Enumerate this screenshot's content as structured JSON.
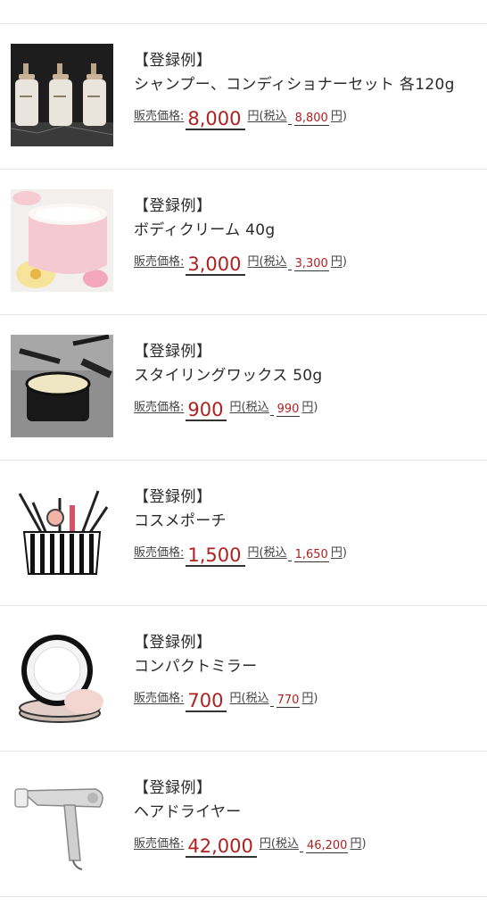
{
  "items": [
    {
      "tag": "【登録例】",
      "name": "シャンプー、コンディショナーセット 各120g",
      "label": "販売価格:",
      "price": "8,000",
      "yen": "円",
      "tax_open": "(税込",
      "tax_price": "8,800",
      "yen2": "円",
      "tax_close": ")",
      "icon": "shampoo-bottles-image"
    },
    {
      "tag": "【登録例】",
      "name": "ボディクリーム 40g",
      "label": "販売価格:",
      "price": "3,000",
      "yen": "円",
      "tax_open": "(税込",
      "tax_price": "3,300",
      "yen2": "円",
      "tax_close": ")",
      "icon": "body-cream-jar-image"
    },
    {
      "tag": "【登録例】",
      "name": "スタイリングワックス 50g",
      "label": "販売価格:",
      "price": "900",
      "yen": "円",
      "tax_open": "(税込",
      "tax_price": "990",
      "yen2": "円",
      "tax_close": ")",
      "icon": "styling-wax-image"
    },
    {
      "tag": "【登録例】",
      "name": "コスメポーチ",
      "label": "販売価格:",
      "price": "1,500",
      "yen": "円",
      "tax_open": "(税込",
      "tax_price": "1,650",
      "yen2": "円",
      "tax_close": ")",
      "icon": "cosme-pouch-image"
    },
    {
      "tag": "【登録例】",
      "name": "コンパクトミラー",
      "label": "販売価格:",
      "price": "700",
      "yen": "円",
      "tax_open": "(税込",
      "tax_price": "770",
      "yen2": "円",
      "tax_close": ")",
      "icon": "compact-mirror-image"
    },
    {
      "tag": "【登録例】",
      "name": "ヘアドライヤー",
      "label": "販売価格:",
      "price": "42,000",
      "yen": "円",
      "tax_open": "(税込",
      "tax_price": "46,200",
      "yen2": "円",
      "tax_close": ")",
      "icon": "hair-dryer-image"
    }
  ],
  "colors": {
    "price": "#b0201f",
    "divider": "#e6e6e6"
  }
}
